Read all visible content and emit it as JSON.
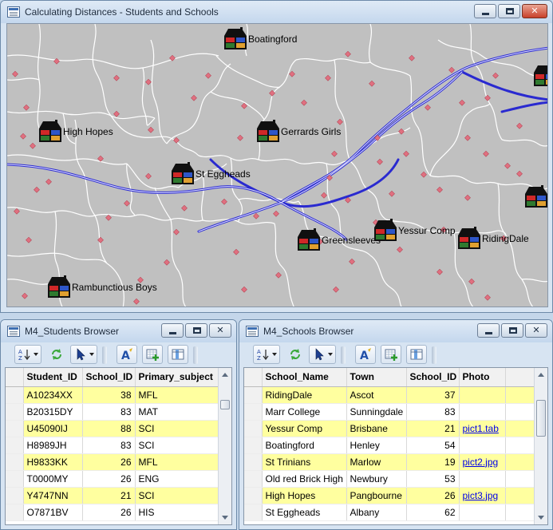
{
  "main_window": {
    "title": "Calculating Distances - Students and Schools",
    "schools": [
      {
        "name": "Boatingford"
      },
      {
        "name": "High Hopes"
      },
      {
        "name": "Gerrards Girls"
      },
      {
        "name": "St Eggheads"
      },
      {
        "name": "Greensleeves"
      },
      {
        "name": "Yessur Comp"
      },
      {
        "name": "RidingDale"
      },
      {
        "name": "Rambunctious Boys"
      },
      {
        "name": ""
      },
      {
        "name": ""
      }
    ]
  },
  "students_browser": {
    "title": "M4_Students Browser",
    "columns": [
      "Student_ID",
      "School_ID",
      "Primary_subject"
    ],
    "rows": [
      {
        "student_id": "A10234XX",
        "school_id": "38",
        "subject": "MFL",
        "highlight": true
      },
      {
        "student_id": "B20315DY",
        "school_id": "83",
        "subject": "MAT",
        "highlight": false
      },
      {
        "student_id": "U45090IJ",
        "school_id": "88",
        "subject": "SCI",
        "highlight": true
      },
      {
        "student_id": "H8989JH",
        "school_id": "83",
        "subject": "SCI",
        "highlight": false
      },
      {
        "student_id": "H9833KK",
        "school_id": "26",
        "subject": "MFL",
        "highlight": true
      },
      {
        "student_id": "T0000MY",
        "school_id": "26",
        "subject": "ENG",
        "highlight": false
      },
      {
        "student_id": "Y4747NN",
        "school_id": "21",
        "subject": "SCI",
        "highlight": true
      },
      {
        "student_id": "O7871BV",
        "school_id": "26",
        "subject": "HIS",
        "highlight": false
      }
    ]
  },
  "schools_browser": {
    "title": "M4_Schools Browser",
    "columns": [
      "School_Name",
      "Town",
      "School_ID",
      "Photo"
    ],
    "rows": [
      {
        "name": "RidingDale",
        "town": "Ascot",
        "school_id": "37",
        "photo": "",
        "highlight": true
      },
      {
        "name": "Marr College",
        "town": "Sunningdale",
        "school_id": "83",
        "photo": "",
        "highlight": false
      },
      {
        "name": "Yessur Comp",
        "town": "Brisbane",
        "school_id": "21",
        "photo": "pict1.tab",
        "highlight": true
      },
      {
        "name": "Boatingford",
        "town": "Henley",
        "school_id": "54",
        "photo": "",
        "highlight": false
      },
      {
        "name": "St Trinians",
        "town": "Marlow",
        "school_id": "19",
        "photo": "pict2.jpg",
        "highlight": true
      },
      {
        "name": "Old red Brick High",
        "town": "Newbury",
        "school_id": "53",
        "photo": "",
        "highlight": false
      },
      {
        "name": "High Hopes",
        "town": "Pangbourne",
        "school_id": "26",
        "photo": "pict3.jpg",
        "highlight": true
      },
      {
        "name": "St Eggheads",
        "town": "Albany",
        "school_id": "62",
        "photo": "",
        "highlight": false
      }
    ]
  },
  "window_controls": {
    "minimize": "",
    "maximize": "",
    "close": "✕"
  },
  "colors": {
    "map_background": "#c0c0c0",
    "region_borders": "#ffffff",
    "roads": "#2a2ad0",
    "student_points": "#e07080",
    "row_highlight": "#ffff9f",
    "link": "#0000e8"
  },
  "icons": {
    "style": "house-icon",
    "select": "select-arrow-icon",
    "refresh": "refresh-icon",
    "label": "label-tool-icon",
    "add_record": "add-record-icon",
    "pick_fields": "pick-fields-icon"
  }
}
